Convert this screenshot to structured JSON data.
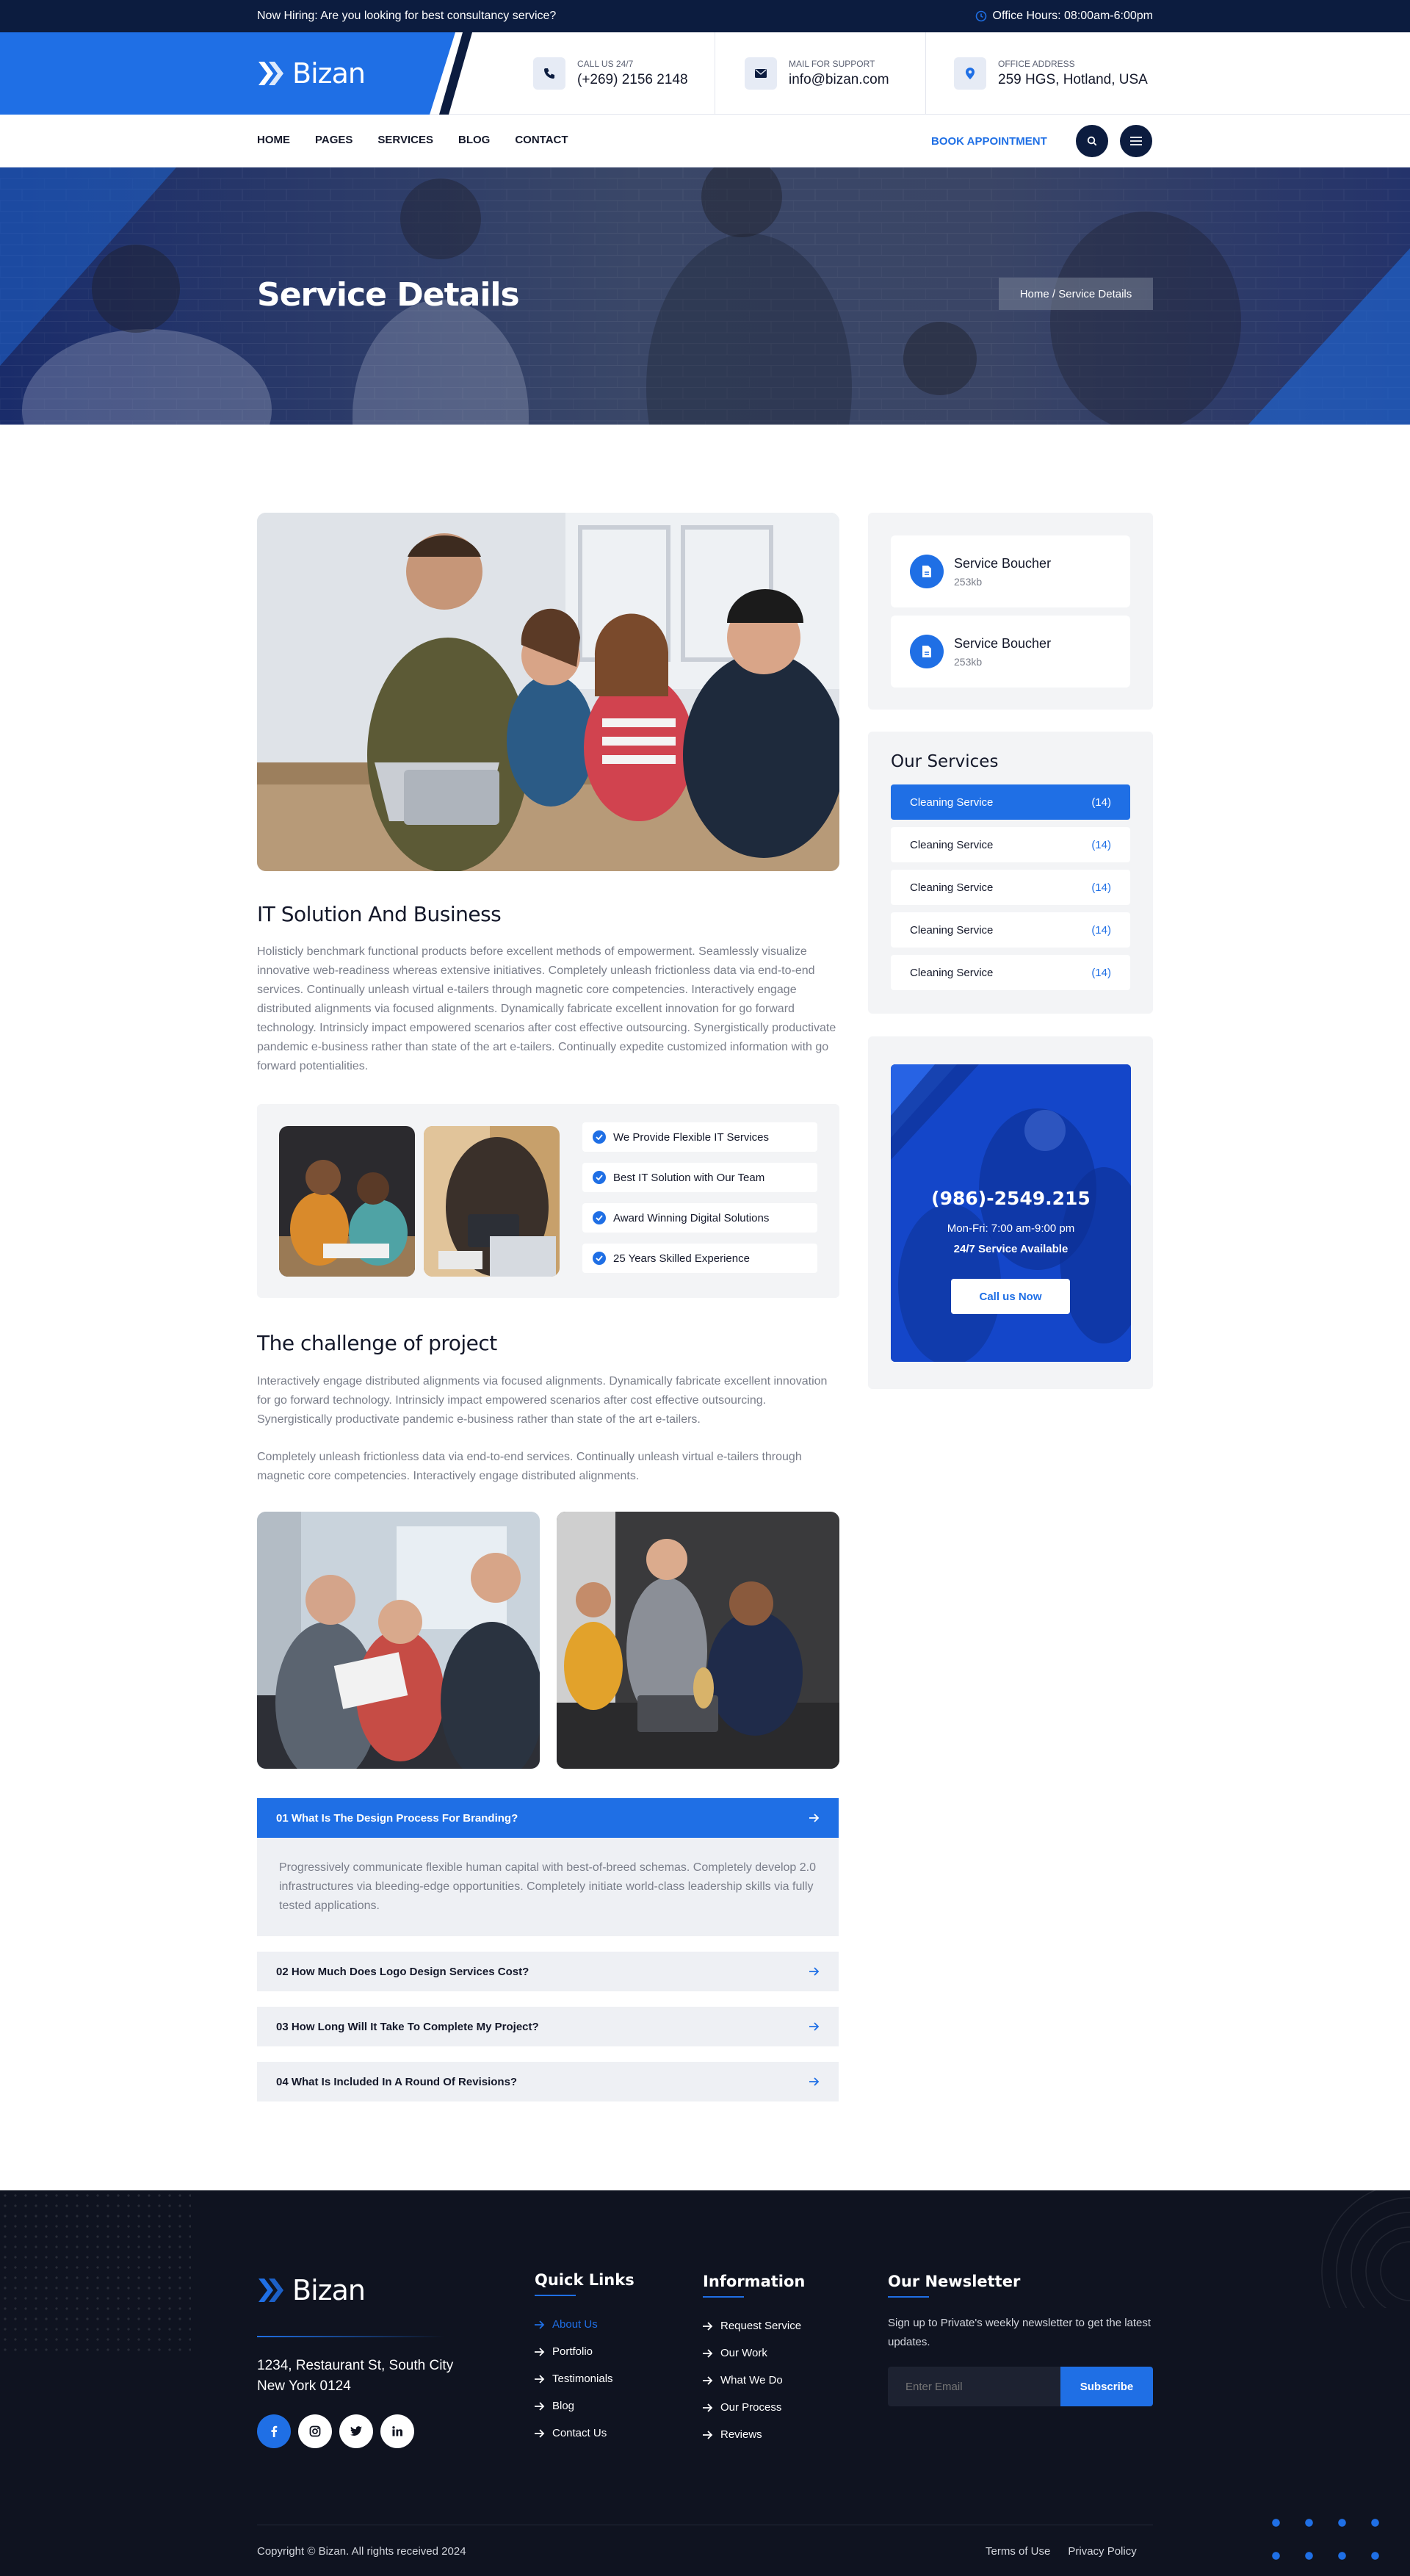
{
  "topbar": {
    "hiring": "Now Hiring: Are you looking for best consultancy service?",
    "hours": "Office Hours: 08:00am-6:00pm"
  },
  "header": {
    "logo": "Bizan",
    "call": {
      "label": "CALL US 24/7",
      "value": "(+269) 2156 2148",
      "icon": "phone-icon"
    },
    "mail": {
      "label": "MAIL FOR SUPPORT",
      "value": "info@bizan.com",
      "icon": "mail-icon"
    },
    "address": {
      "label": "OFFICE ADDRESS",
      "value": "259 HGS, Hotland, USA",
      "icon": "location-icon"
    }
  },
  "nav": {
    "items": [
      "HOME",
      "PAGES",
      "SERVICES",
      "BLOG",
      "CONTACT"
    ],
    "book": "BOOK APPOINTMENT"
  },
  "banner": {
    "title": "Service Details",
    "breadcrumb": "Home / Service Details"
  },
  "main": {
    "title": "IT Solution And Business",
    "paragraph": "Holisticly benchmark functional products before excellent methods of empowerment. Seamlessly visualize innovative web-readiness whereas extensive initiatives. Completely unleash frictionless data via end-to-end services. Continually unleash virtual e-tailers through magnetic core competencies. Interactively engage distributed alignments via focused alignments. Dynamically fabricate excellent innovation for go forward technology. Intrinsicly impact empowered scenarios after cost effective outsourcing. Synergistically productivate pandemic e-business rather than state of the art e-tailers. Continually expedite customized information with go forward potentialities.",
    "features": [
      "We Provide Flexible IT Services",
      "Best IT Solution with Our Team",
      "Award Winning Digital Solutions",
      "25 Years Skilled Experience"
    ],
    "challenge_title": "The challenge of project",
    "challenge_p1": "Interactively engage distributed alignments via focused alignments. Dynamically fabricate excellent innovation for go forward technology. Intrinsicly impact empowered scenarios after cost effective outsourcing. Synergistically productivate pandemic e-business rather than state of the art e-tailers.",
    "challenge_p2": "Completely unleash frictionless data via end-to-end services. Continually unleash virtual e-tailers through magnetic core competencies. Interactively engage distributed alignments.",
    "faq": [
      {
        "q": "01 What Is The Design Process For Branding?",
        "a": "Progressively communicate flexible human capital with best-of-breed schemas. Completely develop 2.0 infrastructures via bleeding-edge opportunities. Completely initiate world-class leadership skills via fully tested applications."
      },
      {
        "q": "02 How Much Does Logo Design Services Cost?"
      },
      {
        "q": "03 How Long Will It Take To Complete My Project?"
      },
      {
        "q": "04 What Is Included In A Round Of Revisions?"
      }
    ]
  },
  "sidebar": {
    "downloads": [
      {
        "title": "Service Boucher",
        "size": "253kb"
      },
      {
        "title": "Service Boucher",
        "size": "253kb"
      }
    ],
    "services_title": "Our Services",
    "services": [
      {
        "name": "Cleaning Service",
        "count": "(14)"
      },
      {
        "name": "Cleaning Service",
        "count": "(14)"
      },
      {
        "name": "Cleaning Service",
        "count": "(14)"
      },
      {
        "name": "Cleaning Service",
        "count": "(14)"
      },
      {
        "name": "Cleaning Service",
        "count": "(14)"
      }
    ],
    "cta": {
      "phone": "(986)-2549.215",
      "hours": "Mon-Fri: 7:00 am-9:00 pm",
      "note": "24/7 Service Available",
      "button": "Call us Now"
    }
  },
  "footer": {
    "logo": "Bizan",
    "address_line1": "1234, Restaurant St, South City",
    "address_line2": "New York 0124",
    "quick_links_title": "Quick Links",
    "quick_links": [
      "About Us",
      "Portfolio",
      "Testimonials",
      "Blog",
      "Contact Us"
    ],
    "information_title": "Information",
    "information": [
      "Request Service",
      "Our Work",
      "What We Do",
      "Our Process",
      "Reviews"
    ],
    "newsletter_title": "Our Newsletter",
    "newsletter_text": "Sign up to Private's weekly newsletter to get the latest updates.",
    "email_placeholder": "Enter Email",
    "subscribe": "Subscribe",
    "copyright": "Copyright © Bizan. All rights received 2024",
    "terms": "Terms of Use",
    "privacy": "Privacy Policy"
  },
  "colors": {
    "primary": "#1f6fe5",
    "navy": "#0c1c3f",
    "footer_bg": "#0f1320"
  }
}
